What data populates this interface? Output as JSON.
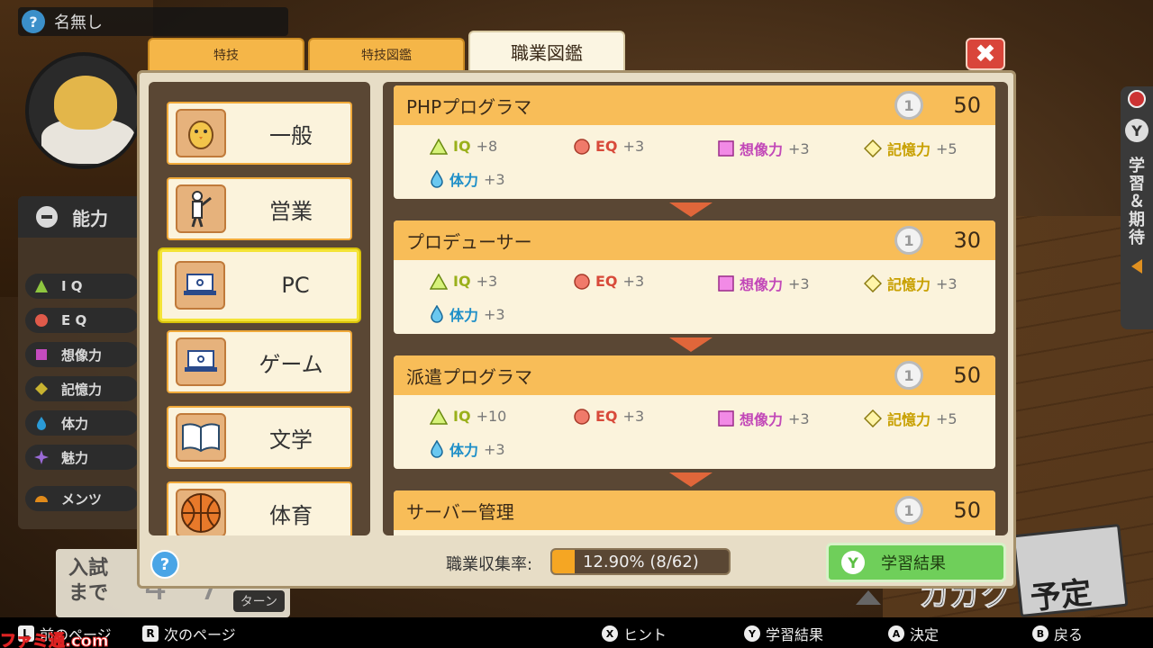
{
  "top": {
    "help_icon": "?",
    "player_name": "名無し"
  },
  "stats": {
    "title": "能力",
    "items": [
      {
        "label": "I Q",
        "color": "#8ec63f",
        "shape": "triangle"
      },
      {
        "label": "E Q",
        "color": "#e05a4a",
        "shape": "circle"
      },
      {
        "label": "想像力",
        "color": "#c54bbf",
        "shape": "square"
      },
      {
        "label": "記憶力",
        "color": "#c8b330",
        "shape": "diamond"
      },
      {
        "label": "体力",
        "color": "#2a9ad6",
        "shape": "drop"
      },
      {
        "label": "魅力",
        "color": "#9a6ad6",
        "shape": "star"
      },
      {
        "label": "メンツ",
        "color": "#e08a1a",
        "shape": "half"
      }
    ]
  },
  "counter": {
    "label_line1": "入試",
    "label_line2": "まで",
    "digit1": "4",
    "digit2": "7",
    "turn": "ターン"
  },
  "side_tab": {
    "button": "Y",
    "text": "学習＆期待"
  },
  "background": {
    "word": "カガク",
    "notepad": "予定"
  },
  "tabs": [
    {
      "label": "特技"
    },
    {
      "label": "特技図鑑"
    },
    {
      "label": "職業図鑑"
    }
  ],
  "close_icon": "✖",
  "categories": [
    {
      "label": "一般",
      "icon": "chick-icon"
    },
    {
      "label": "営業",
      "icon": "salesman-icon"
    },
    {
      "label": "PC",
      "icon": "laptop-icon"
    },
    {
      "label": "ゲーム",
      "icon": "laptop-icon"
    },
    {
      "label": "文学",
      "icon": "book-icon"
    },
    {
      "label": "体育",
      "icon": "basketball-icon"
    }
  ],
  "selected_category": "PC",
  "jobs": [
    {
      "name": "PHPプログラマ",
      "coin": "1",
      "cost": "50",
      "attrs": {
        "iq": "+8",
        "eq": "+3",
        "imagination": "+3",
        "memory": "+5",
        "stamina": "+3"
      }
    },
    {
      "name": "プロデューサー",
      "coin": "1",
      "cost": "30",
      "attrs": {
        "iq": "+3",
        "eq": "+3",
        "imagination": "+3",
        "memory": "+3",
        "stamina": "+3"
      }
    },
    {
      "name": "派遣プログラマ",
      "coin": "1",
      "cost": "50",
      "attrs": {
        "iq": "+10",
        "eq": "+3",
        "imagination": "+3",
        "memory": "+5",
        "stamina": "+3"
      }
    },
    {
      "name": "サーバー管理",
      "coin": "1",
      "cost": "50"
    }
  ],
  "attr_labels": {
    "iq": "IQ",
    "eq": "EQ",
    "imagination": "想像力",
    "memory": "記憶力",
    "stamina": "体力"
  },
  "footer": {
    "help": "?",
    "rate_label": "職業収集率:",
    "rate_text": "12.90% (8/62)",
    "rate_fraction": 0.129,
    "learn_button_key": "Y",
    "learn_button_label": "学習結果"
  },
  "bottom_bar": {
    "prev_key": "L",
    "prev_label": "前のページ",
    "next_key": "R",
    "next_label": "次のページ",
    "hint_key": "X",
    "hint_label": "ヒント",
    "learn_key": "Y",
    "learn_label": "学習結果",
    "ok_key": "A",
    "ok_label": "決定",
    "back_key": "B",
    "back_label": "戻る"
  },
  "watermark": "ファミ通.com"
}
